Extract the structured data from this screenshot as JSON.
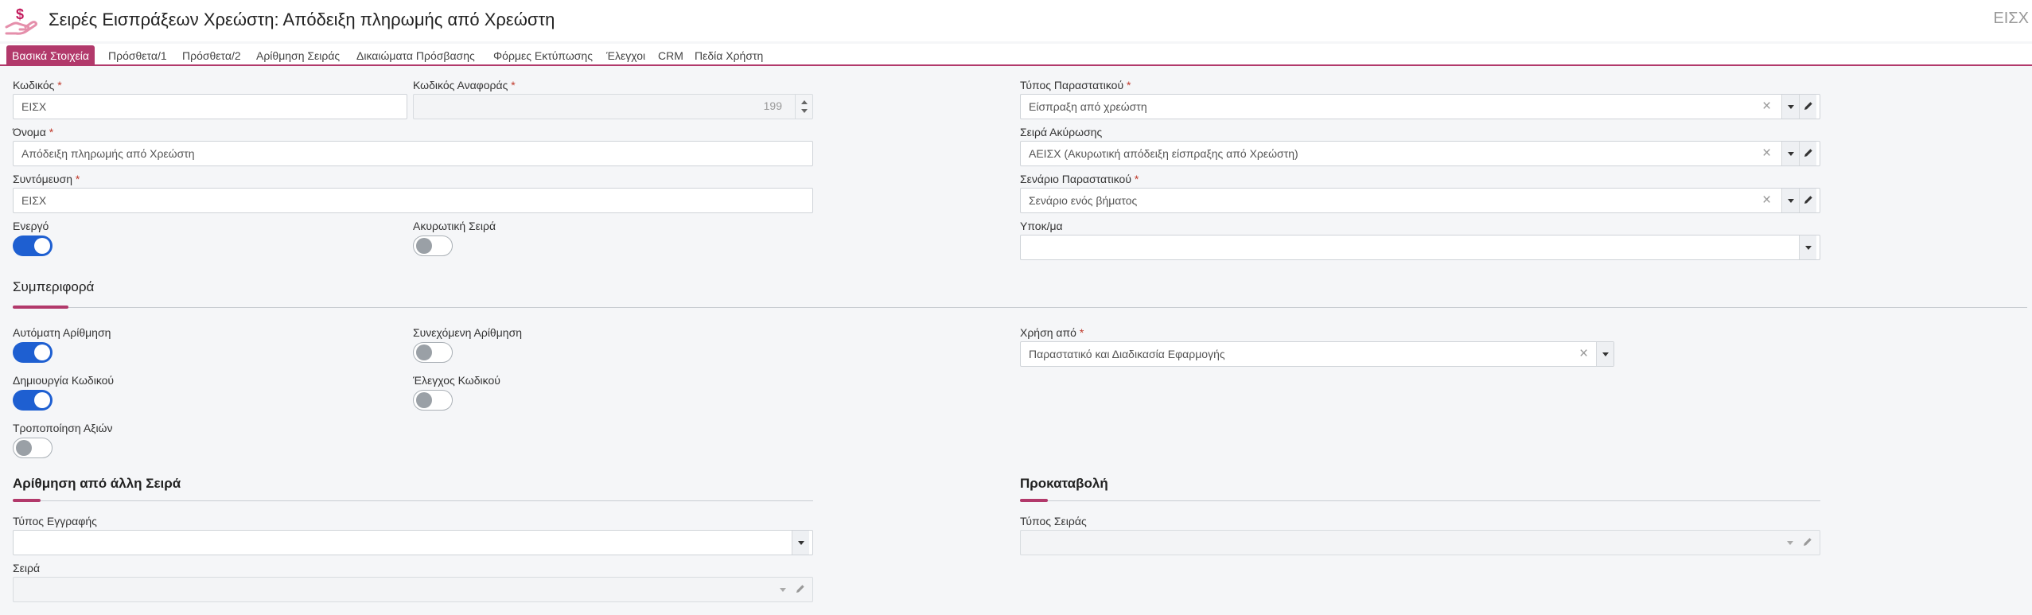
{
  "header": {
    "title": "Σειρές Εισπράξεων Χρεώστη: Απόδειξη πληρωμής από Χρεώστη",
    "code": "ΕΙΣΧ",
    "icon": "money-hand-icon",
    "accent_color": "#b2396b"
  },
  "tabs": [
    "Βασικά Στοιχεία",
    "Πρόσθετα/1",
    "Πρόσθετα/2",
    "Αρίθμηση Σειράς",
    "Δικαιώματα Πρόσβασης",
    "Φόρμες Εκτύπωσης",
    "Έλεγχοι",
    "CRM",
    "Πεδία Χρήστη"
  ],
  "active_tab": "Βασικά Στοιχεία",
  "form": {
    "code": {
      "label": "Κωδικός",
      "value": "ΕΙΣΧ"
    },
    "reference_code": {
      "label": "Κωδικός Αναφοράς",
      "value": "199"
    },
    "name": {
      "label": "Όνομα",
      "value": "Απόδειξη πληρωμής από Χρεώστη"
    },
    "abbreviation": {
      "label": "Συντόμευση",
      "value": "ΕΙΣΧ"
    },
    "active": {
      "label": "Ενεργό",
      "on": true
    },
    "cancel_series": {
      "label": "Ακυρωτική Σειρά",
      "on": false
    },
    "document_type": {
      "label": "Τύπος Παραστατικού",
      "value": "Είσπραξη από χρεώστη"
    },
    "cancellation_series": {
      "label": "Σειρά Ακύρωσης",
      "value": "ΑΕΙΣΧ (Ακυρωτική απόδειξη είσπραξης από Χρεώστη)"
    },
    "document_scenario": {
      "label": "Σενάριο Παραστατικού",
      "value": "Σενάριο ενός βήματος"
    },
    "branch": {
      "label": "Υποκ/μα",
      "value": ""
    }
  },
  "behavior": {
    "title": "Συμπεριφορά",
    "auto_numbering": {
      "label": "Αυτόματη Αρίθμηση",
      "on": true
    },
    "continuous_numbering": {
      "label": "Συνεχόμενη Αρίθμηση",
      "on": false
    },
    "create_code": {
      "label": "Δημιουργία Κωδικού",
      "on": true
    },
    "code_check": {
      "label": "Έλεγχος Κωδικού",
      "on": false
    },
    "modify_values": {
      "label": "Τροποποίηση Αξιών",
      "on": false
    },
    "used_from": {
      "label": "Χρήση από",
      "value": "Παραστατικό και Διαδικασία Εφαρμογής"
    }
  },
  "numbering_other": {
    "title": "Αρίθμηση από άλλη Σειρά",
    "record_type": {
      "label": "Τύπος Εγγραφής",
      "value": ""
    },
    "series": {
      "label": "Σειρά",
      "value": ""
    }
  },
  "advance": {
    "title": "Προκαταβολή",
    "series_type": {
      "label": "Τύπος Σειράς",
      "value": ""
    }
  }
}
